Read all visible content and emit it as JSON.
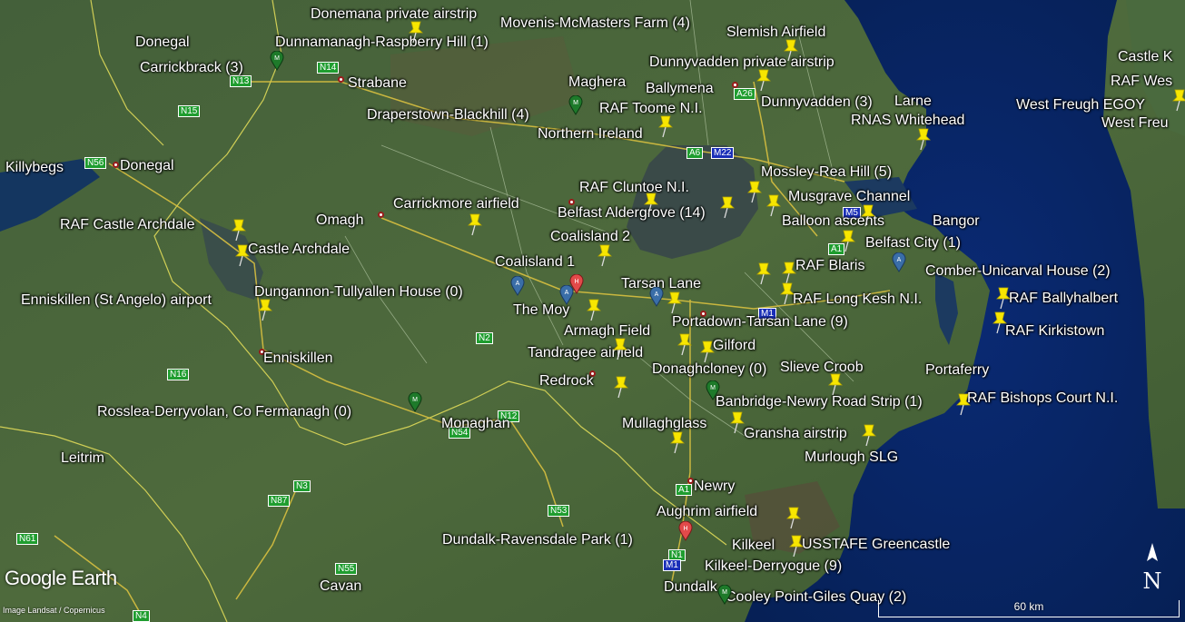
{
  "map": {
    "logo": "Google Earth",
    "attribution": "Image Landsat / Copernicus",
    "scale_label": "60 km",
    "north_label": "N",
    "colors": {
      "label": "#ffffff",
      "pin": "#f7e600",
      "road_primary": "#1f9d2f",
      "motorway": "#1a2fb8",
      "sea": "#0c2a6e",
      "land": "#3d5a30"
    },
    "labels": {
      "donemana": "Donemana private airstrip",
      "movenis": "Movenis-McMasters Farm (4)",
      "slemish": "Slemish Airfield",
      "donegal_top": "Donegal",
      "dunnamanagh": "Dunnamanagh-Raspberry Hill (1)",
      "castle_ken": "Castle K",
      "carrickbrack": "Carrickbrack (3)",
      "dunnyvadden_priv": "Dunnyvadden private airstrip",
      "raf_west": "RAF Wes",
      "strabane": "Strabane",
      "maghera": "Maghera",
      "ballymena": "Ballymena",
      "dunnyvadden3": "Dunnyvadden (3)",
      "larne": "Larne",
      "west_freugh_egoy": "West Freugh EGOY",
      "west_freu": "West Freu",
      "draperstown": "Draperstown-Blackhill (4)",
      "raf_toome": "RAF Toome N.I.",
      "rnas_whitehead": "RNAS Whitehead",
      "northern_ireland": "Northern Ireland",
      "killybegs": "Killybegs",
      "donegal": "Donegal",
      "mossley": "Mossley-Rea Hill (5)",
      "raf_cluntoe": "RAF Cluntoe N.I.",
      "musgrave": "Musgrave Channel",
      "carrickmore": "Carrickmore airfield",
      "raf_castle_archdale": "RAF Castle Archdale",
      "omagh": "Omagh",
      "belfast_aldergrove": "Belfast Aldergrove (14)",
      "balloon": "Balloon ascents",
      "bangor": "Bangor",
      "coalisland2": "Coalisland 2",
      "belfast_city": "Belfast City (1)",
      "castle_archdale": "Castle Archdale",
      "coalisland1": "Coalisland 1",
      "raf_blaris": "RAF Blaris",
      "comber": "Comber-Unicarval House (2)",
      "tarsan_lane": "Tarsan Lane",
      "dungannon": "Dungannon-Tullyallen House (0)",
      "raf_ballyhalbert": "RAF Ballyhalbert",
      "enniskillen_airport": "Enniskillen (St Angelo) airport",
      "the_moy": "The Moy",
      "raf_long_kesh": "RAF Long Kesh N.I.",
      "portadown": "Portadown-Tarsan Lane (9)",
      "armagh_field": "Armagh Field",
      "raf_kirkistown": "RAF Kirkistown",
      "gilford": "Gilford",
      "tandragee": "Tandragee airfield",
      "enniskillen": "Enniskillen",
      "slieve_croob": "Slieve Croob",
      "donaghcloney": "Donaghcloney (0)",
      "portaferry": "Portaferry",
      "redrock": "Redrock",
      "raf_bishops_court": "RAF Bishops Court N.I.",
      "banbridge": "Banbridge-Newry Road Strip (1)",
      "rosslea": "Rosslea-Derryvolan, Co Fermanagh (0)",
      "monaghan": "Monaghan",
      "mullaghglass": "Mullaghglass",
      "gransha": "Gransha airstrip",
      "leitrim": "Leitrim",
      "murlough": "Murlough SLG",
      "newry": "Newry",
      "aughrim": "Aughrim airfield",
      "dundalk_ravensdale": "Dundalk-Ravensdale Park (1)",
      "kilkeel": "Kilkeel",
      "usstafe": "USSTAFE Greencastle",
      "kilkeel_derryogue": "Kilkeel-Derryogue (9)",
      "cavan": "Cavan",
      "dundalk": "Dundalk",
      "cooley": "Cooley Point-Giles Quay (2)"
    },
    "roads": {
      "n14": "N14",
      "n13": "N13",
      "n15": "N15",
      "n56": "N56",
      "a26": "A26",
      "a6": "A6",
      "m22": "M22",
      "m5": "M5",
      "a1": "A1",
      "m1": "M1",
      "n2": "N2",
      "n16": "N16",
      "n12": "N12",
      "n54": "N54",
      "n3": "N3",
      "n87": "N87",
      "n53": "N53",
      "a1b": "A1",
      "n1": "N1",
      "m1b": "M1",
      "n61": "N61",
      "n55": "N55",
      "n4": "N4"
    }
  }
}
